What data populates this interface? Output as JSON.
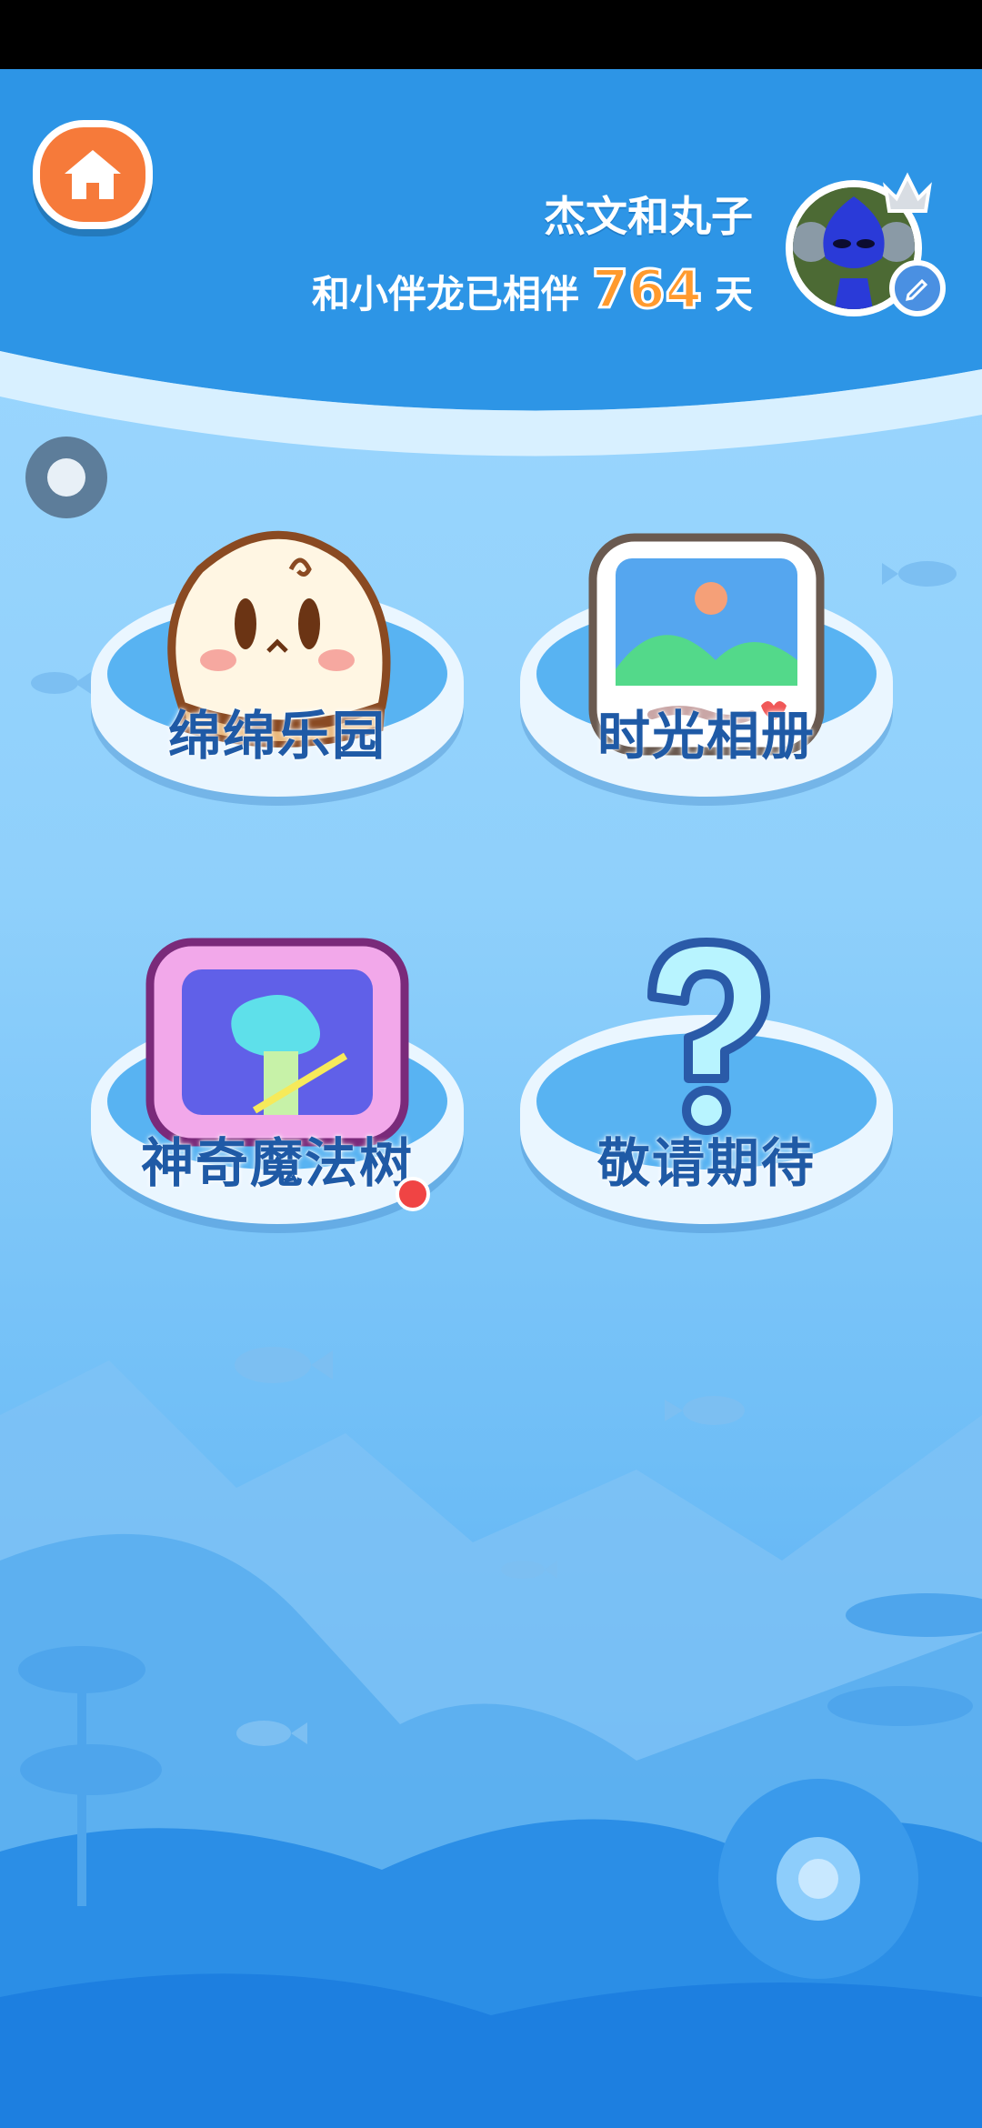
{
  "header": {
    "user_name": "杰文和丸子",
    "companion_prefix": "和小伴龙已相伴",
    "companion_days": "764",
    "companion_suffix": "天"
  },
  "menu": [
    {
      "label": "绵绵乐园",
      "icon": "marshmallow-icon",
      "badge": false
    },
    {
      "label": "时光相册",
      "icon": "photo-album-icon",
      "badge": false
    },
    {
      "label": "神奇魔法树",
      "icon": "magic-tree-icon",
      "badge": true
    },
    {
      "label": "敬请期待",
      "icon": "question-mark-icon",
      "badge": false
    }
  ],
  "colors": {
    "home_button": "#f67a3a",
    "label": "#1f5aa6",
    "days": "#ff9a2e",
    "badge": "#f04444"
  }
}
